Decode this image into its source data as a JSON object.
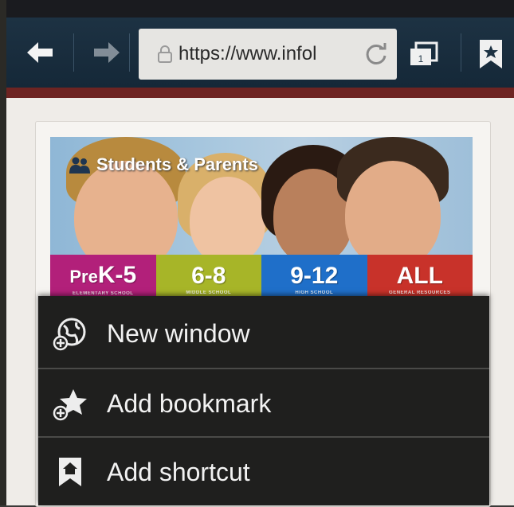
{
  "browser": {
    "url": "https://www.infol"
  },
  "hero": {
    "title": "Students & Parents",
    "grades": [
      {
        "label_prefix": "Pre",
        "label": "K-5",
        "sub": "ELEMENTARY SCHOOL",
        "color": "#b2207a"
      },
      {
        "label_prefix": "",
        "label": "6-8",
        "sub": "MIDDLE SCHOOL",
        "color": "#a7b528"
      },
      {
        "label_prefix": "",
        "label": "9-12",
        "sub": "HIGH SCHOOL",
        "color": "#1f6fc9"
      },
      {
        "label_prefix": "",
        "label": "ALL",
        "sub": "GENERAL RESOURCES",
        "color": "#c8322a"
      }
    ]
  },
  "menu": {
    "items": [
      {
        "label": "New window",
        "icon": "globe-plus-icon"
      },
      {
        "label": "Add bookmark",
        "icon": "star-plus-icon"
      },
      {
        "label": "Add shortcut",
        "icon": "bookmark-home-icon"
      }
    ]
  },
  "colors": {
    "toolbar": "#1d3243",
    "accent_strip": "#6e2422",
    "menu_bg": "#1f1f1e"
  }
}
